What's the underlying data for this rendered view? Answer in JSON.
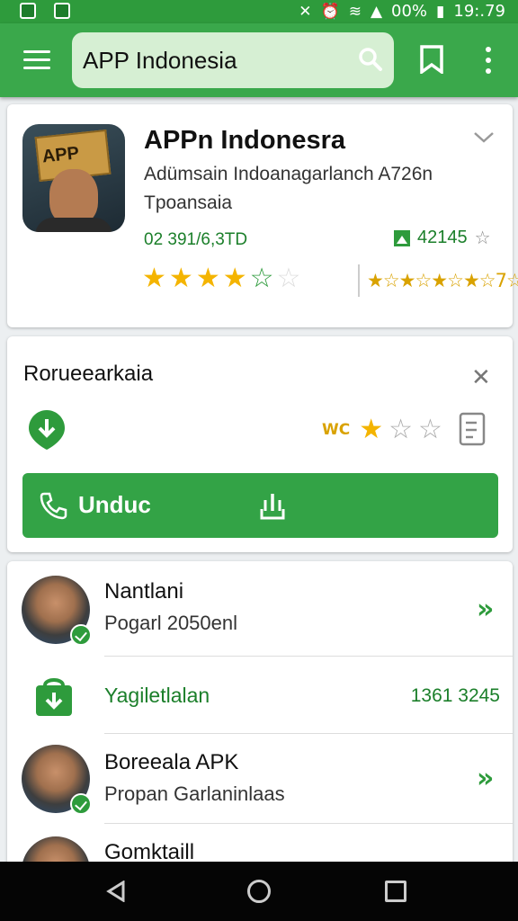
{
  "status_bar": {
    "battery": "00%",
    "time": "19:.79"
  },
  "app_bar": {
    "search_text": "APP Indonesia"
  },
  "app_card": {
    "icon_text": "APP",
    "title": "APPn Indonesra",
    "subtitle_line1": "Adümsain Indoanagarlanch A726n",
    "subtitle_line2": "Tpoansaia",
    "downloads": "02 391/6,3TD",
    "review_count": "42145",
    "rating_stars_full": 4,
    "rating_stars_half": 1
  },
  "install_card": {
    "title": "Rorueearkaia",
    "rating_prefix": "WC",
    "stars_filled": 1,
    "stars_total": 3,
    "button_label": "Unduc"
  },
  "list": [
    {
      "title": "Nantlani",
      "subtitle": "Pogarl 2050enl"
    },
    {
      "title": "Yagiletlalan",
      "number": "1361 3245"
    },
    {
      "title": "Boreeala APK",
      "subtitle": "Propan Garlaninlaas"
    },
    {
      "title": "Gomktaill"
    }
  ],
  "colors": {
    "primary": "#3aa84b",
    "dark_green": "#1b7f2a",
    "star": "#f4b400"
  }
}
